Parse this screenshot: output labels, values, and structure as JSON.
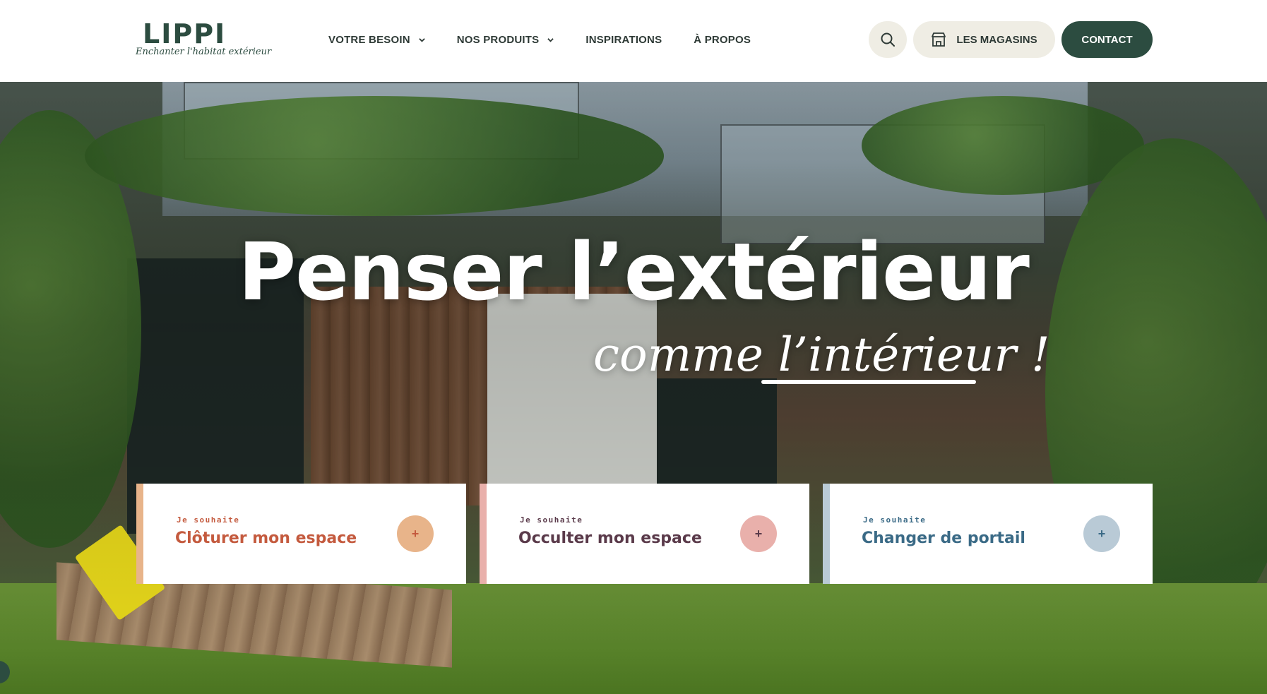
{
  "brand": {
    "name": "LIPPI",
    "tagline": "Enchanter l'habitat extérieur",
    "color": "#2c4c40"
  },
  "nav": [
    {
      "label": "VOTRE BESOIN",
      "has_dropdown": true
    },
    {
      "label": "NOS PRODUITS",
      "has_dropdown": true
    },
    {
      "label": "INSPIRATIONS",
      "has_dropdown": false
    },
    {
      "label": "À PROPOS",
      "has_dropdown": false
    }
  ],
  "header_actions": {
    "search_icon": "search-icon",
    "stores_icon": "store-icon",
    "stores_label": "LES MAGASINS",
    "contact_label": "CONTACT"
  },
  "hero": {
    "title": "Penser l’extérieur",
    "script_line": "comme l’intérieur !"
  },
  "cards": [
    {
      "kicker": "Je souhaite",
      "title": "Clôturer mon espace",
      "accent": "#e8b48a",
      "text_color": "#c45a3e",
      "plus": "+"
    },
    {
      "kicker": "Je souhaite",
      "title": "Occulter mon espace",
      "accent": "#e9b0ab",
      "text_color": "#5a3a4a",
      "plus": "+"
    },
    {
      "kicker": "Je souhaite",
      "title": "Changer de portail",
      "accent": "#b9cad6",
      "text_color": "#3a6a86",
      "plus": "+"
    }
  ]
}
